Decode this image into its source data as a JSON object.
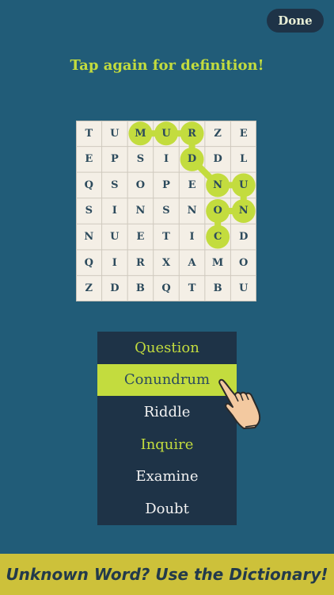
{
  "header": {
    "done_label": "Done"
  },
  "hint": "Tap again for definition!",
  "puzzle": {
    "rows": [
      [
        "T",
        "U",
        "M",
        "U",
        "R",
        "Z",
        "E"
      ],
      [
        "E",
        "P",
        "S",
        "I",
        "D",
        "D",
        "L"
      ],
      [
        "Q",
        "S",
        "O",
        "P",
        "E",
        "N",
        "U"
      ],
      [
        "S",
        "I",
        "N",
        "S",
        "N",
        "O",
        "N"
      ],
      [
        "N",
        "U",
        "E",
        "T",
        "I",
        "C",
        "D"
      ],
      [
        "Q",
        "I",
        "R",
        "X",
        "A",
        "M",
        "O"
      ],
      [
        "Z",
        "D",
        "B",
        "Q",
        "T",
        "B",
        "U"
      ]
    ],
    "selected_path": [
      [
        0,
        2
      ],
      [
        0,
        3
      ],
      [
        0,
        4
      ],
      [
        1,
        4
      ],
      [
        2,
        5
      ],
      [
        2,
        6
      ],
      [
        3,
        6
      ],
      [
        3,
        5
      ],
      [
        4,
        5
      ]
    ],
    "highlight_color": "#c3dc3e"
  },
  "menu": {
    "items": [
      {
        "label": "Question",
        "style": "green"
      },
      {
        "label": "Conundrum",
        "style": "selected"
      },
      {
        "label": "Riddle",
        "style": "normal"
      },
      {
        "label": "Inquire",
        "style": "green"
      },
      {
        "label": "Examine",
        "style": "normal"
      },
      {
        "label": "Doubt",
        "style": "normal"
      }
    ]
  },
  "banner": {
    "text": "Unknown Word? Use the Dictionary!"
  },
  "colors": {
    "background": "#215c78",
    "accent": "#c3dc3e",
    "panel": "#1e3347",
    "banner": "#cdc13a",
    "grid_bg": "#f4efe6"
  }
}
